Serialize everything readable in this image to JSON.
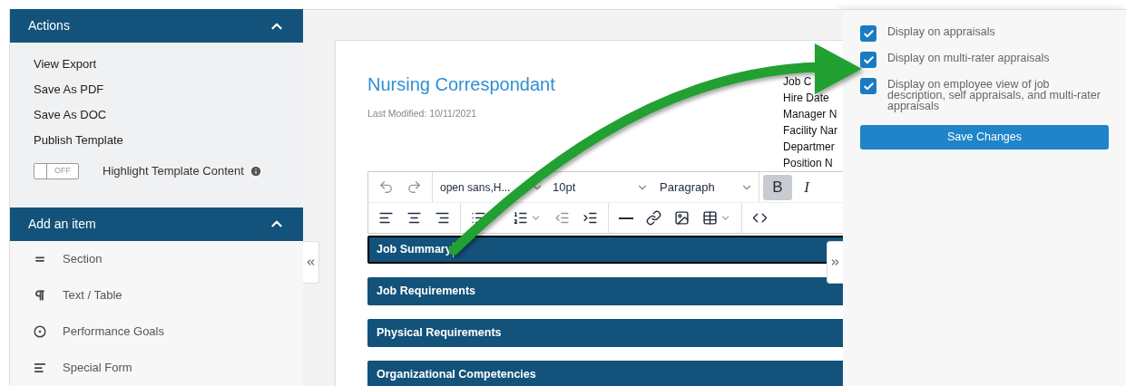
{
  "sidebar": {
    "actions": {
      "title": "Actions",
      "expanded": true,
      "links": [
        "View Export",
        "Save As PDF",
        "Save As DOC",
        "Publish Template"
      ],
      "toggle": {
        "label": "OFF",
        "on": false,
        "caption": "Highlight Template Content"
      }
    },
    "add_item": {
      "title": "Add an item",
      "expanded": true,
      "items": [
        {
          "label": "Section",
          "kind": "section"
        },
        {
          "label": "Text / Table",
          "kind": "text"
        },
        {
          "label": "Performance Goals",
          "kind": "goals"
        },
        {
          "label": "Special Form",
          "kind": "form"
        }
      ]
    }
  },
  "document": {
    "title": "Nursing Correspondant",
    "last_modified": "Last Modified: 10/11/2021",
    "fields": [
      "Job C",
      "Hire Date",
      "Manager N",
      "Facility Nar",
      "Departmer",
      "Position N"
    ],
    "toolbar": {
      "font": "open sans,H...",
      "size": "10pt",
      "block": "Paragraph",
      "bold": {
        "label": "B",
        "selected": true
      },
      "italic": {
        "label": "I",
        "selected": false
      }
    },
    "sections": [
      {
        "title": "Job Summary",
        "focused": true
      },
      {
        "title": "Job Requirements",
        "focused": false
      },
      {
        "title": "Physical Requirements",
        "focused": false
      },
      {
        "title": "Organizational Competencies",
        "focused": false
      }
    ]
  },
  "settings_panel": {
    "options": [
      {
        "label": "Display on appraisals",
        "checked": true
      },
      {
        "label": "Display on multi-rater appraisals",
        "checked": true
      },
      {
        "label": "Display on employee view of job description, self appraisals, and multi-rater appraisals",
        "checked": true
      }
    ],
    "button": "Save Changes"
  }
}
